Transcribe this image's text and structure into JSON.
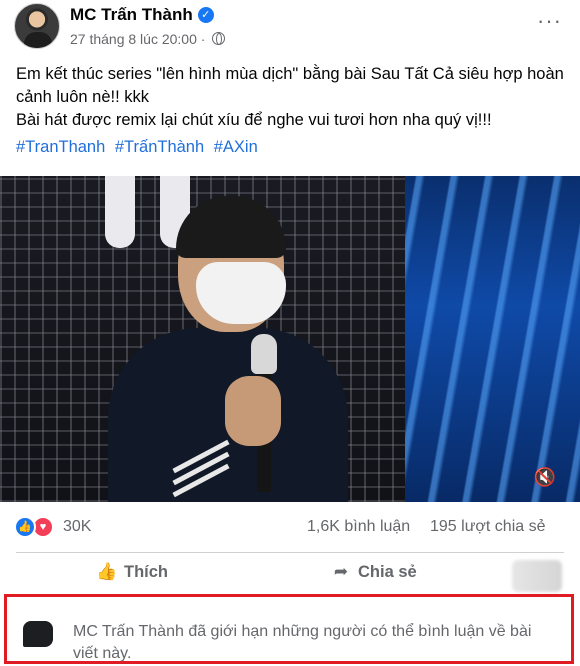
{
  "post": {
    "author": "MC Trấn Thành",
    "timestamp": "27 tháng 8 lúc 20:00",
    "separator": "·",
    "text_line1": "Em kết thúc series \"lên hình mùa dịch\" bằng bài Sau Tất Cả siêu hợp hoàn cảnh luôn nè!! kkk",
    "text_line2": "Bài hát được remix lại chút xíu để nghe vui tươi hơn nha quý vị!!!",
    "hashtags": [
      "#TranThanh",
      "#TrấnThành",
      "#AXin"
    ]
  },
  "stats": {
    "reactions_count": "30K",
    "comments": "1,6K bình luận",
    "shares": "195 lượt chia sẻ"
  },
  "actions": {
    "like_label": "Thích",
    "share_label": "Chia sẻ"
  },
  "restriction": {
    "message": "MC Trấn Thành đã giới hạn những người có thể bình luận về bài viết này."
  },
  "icons": {
    "verified": "verified-badge-icon",
    "privacy": "globe-icon",
    "like": "thumbs-up-icon",
    "share": "share-arrow-icon",
    "mute": "speaker-muted-icon",
    "comment": "comment-bubble-icon"
  },
  "colors": {
    "accent": "#1877f2",
    "hashtag": "#216fdb",
    "highlight_border": "#e11b23",
    "love": "#f33e58"
  }
}
